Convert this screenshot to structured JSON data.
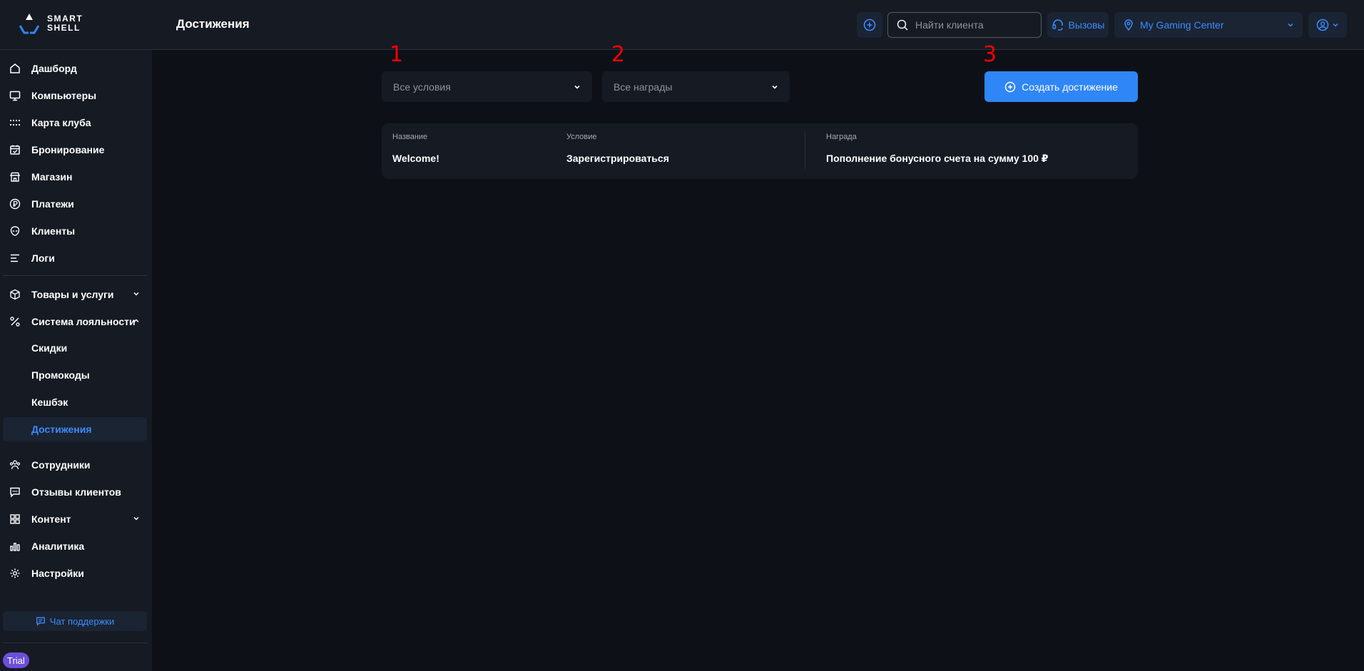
{
  "app": {
    "logo_line1": "SMART",
    "logo_line2": "SHELL",
    "page_title": "Достижения"
  },
  "header": {
    "search_placeholder": "Найти клиента",
    "calls_label": "Вызовы",
    "club_name": "My Gaming Center"
  },
  "sidebar": {
    "items": [
      {
        "label": "Дашборд",
        "icon": "home-icon"
      },
      {
        "label": "Компьютеры",
        "icon": "monitor-icon"
      },
      {
        "label": "Карта клуба",
        "icon": "grid-dots-icon"
      },
      {
        "label": "Бронирование",
        "icon": "calendar-icon"
      },
      {
        "label": "Магазин",
        "icon": "store-icon"
      },
      {
        "label": "Платежи",
        "icon": "ruble-icon"
      },
      {
        "label": "Клиенты",
        "icon": "alien-icon"
      },
      {
        "label": "Логи",
        "icon": "list-icon"
      }
    ],
    "group1": [
      {
        "label": "Товары и услуги",
        "icon": "box-icon"
      },
      {
        "label": "Система лояльности",
        "icon": "percent-icon"
      }
    ],
    "loyalty_sub": [
      "Скидки",
      "Промокоды",
      "Кешбэк",
      "Достижения"
    ],
    "group2": [
      {
        "label": "Сотрудники",
        "icon": "team-icon"
      },
      {
        "label": "Отзывы клиентов",
        "icon": "chat-icon"
      },
      {
        "label": "Контент",
        "icon": "grid-icon"
      },
      {
        "label": "Аналитика",
        "icon": "chart-icon"
      },
      {
        "label": "Настройки",
        "icon": "gear-icon"
      }
    ],
    "support_label": "Чат поддержки",
    "trial_label": "Trial"
  },
  "filters": {
    "conditions": "Все условия",
    "rewards": "Все награды",
    "create_label": "Создать достижение"
  },
  "annotations": [
    "1",
    "2",
    "3"
  ],
  "table": {
    "headers": {
      "name": "Название",
      "condition": "Условие",
      "reward": "Награда"
    },
    "rows": [
      {
        "name": "Welcome!",
        "condition": "Зарегистрироваться",
        "reward": "Пополнение бонусного счета на сумму 100 ₽"
      }
    ]
  },
  "colors": {
    "accent": "#2f86f6",
    "link": "#3b8cff",
    "background": "#0d1117",
    "panel": "#151a23",
    "trial_badge": "#6c4fd8"
  }
}
